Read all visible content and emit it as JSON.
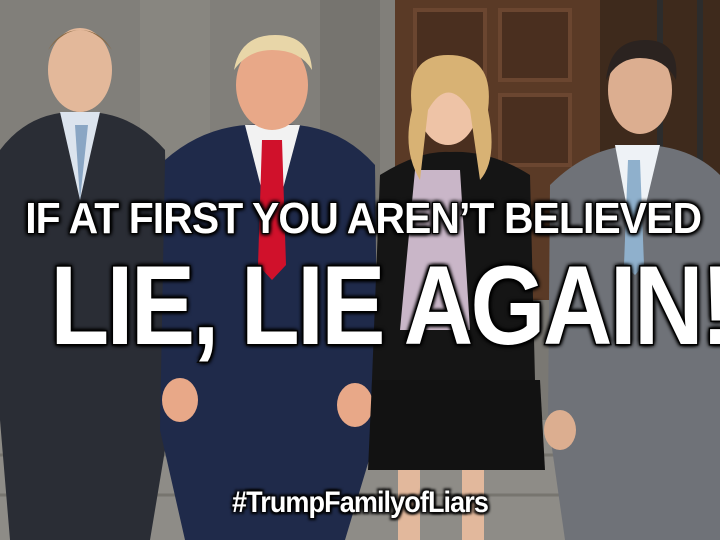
{
  "meme": {
    "caption_line1": "IF AT FIRST YOU AREN’T BELIEVED",
    "caption_line2": "LIE, LIE AGAIN!",
    "hashtag": "#TrumpFamilyofLiars"
  },
  "colors": {
    "caption_fill": "#ffffff",
    "caption_outline": "#111111",
    "red_tie": "#d0112b",
    "navy_suit": "#1f2a4a",
    "gray_suit": "#6f7278",
    "wood_door": "#5a3a26"
  }
}
